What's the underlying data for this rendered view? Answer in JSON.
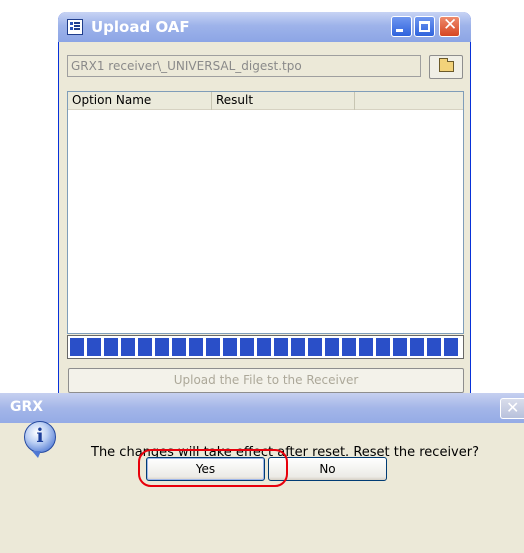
{
  "upload_window": {
    "title": "Upload OAF",
    "file_path": "GRX1 receiver\\_UNIVERSAL_digest.tpo",
    "columns": [
      "Option Name",
      "Result"
    ],
    "progress": 1.0,
    "upload_button_label": "Upload the File to the Receiver"
  },
  "dialog": {
    "title": "GRX",
    "message": "The changes will take effect after reset. Reset the receiver?",
    "yes_label": "Yes",
    "no_label": "No",
    "info_glyph": "i",
    "highlight_color": "#e8000b"
  },
  "icons": {
    "app": "list-app-icon",
    "minimize": "minimize-icon",
    "maximize": "maximize-icon",
    "close": "close-icon",
    "browse": "open-folder-icon",
    "info": "information-icon"
  }
}
